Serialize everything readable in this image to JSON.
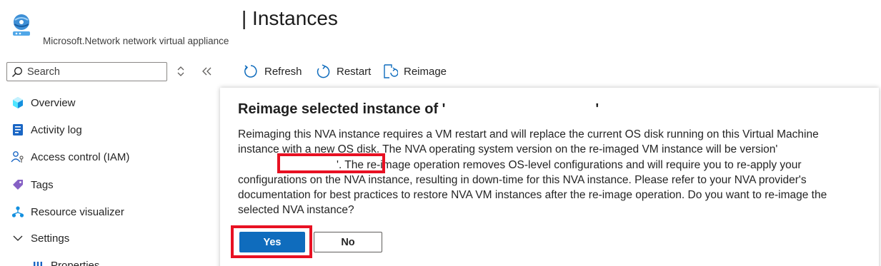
{
  "header": {
    "title": "| Instances",
    "subtitle": "Microsoft.Network network virtual appliance"
  },
  "sidebar": {
    "search_placeholder": "Search",
    "items": [
      {
        "label": "Overview",
        "icon": "overview-icon"
      },
      {
        "label": "Activity log",
        "icon": "activity-log-icon"
      },
      {
        "label": "Access control (IAM)",
        "icon": "access-control-icon"
      },
      {
        "label": "Tags",
        "icon": "tag-icon"
      },
      {
        "label": "Resource visualizer",
        "icon": "resource-visualizer-icon"
      },
      {
        "label": "Settings",
        "icon": "chevron-down-icon"
      },
      {
        "label": "Properties",
        "icon": "properties-icon"
      }
    ]
  },
  "toolbar": {
    "refresh_label": "Refresh",
    "restart_label": "Restart",
    "reimage_label": "Reimage"
  },
  "dialog": {
    "title": "Reimage selected instance of '",
    "title_end": "'",
    "body_part1": "Reimaging this NVA instance requires a VM restart and will replace the current OS disk running on this Virtual Machine instance with a new OS disk. The NVA operating system version on the re-imaged VM instance will be version",
    "quote_open": "'",
    "quote_close": "'.",
    "body_part2": " The re-image operation removes OS-level configurations and will require you to re-apply your configurations on the NVA instance, resulting in down-time for this NVA instance. Please refer to your NVA provider's documentation for best practices to restore NVA VM instances after the re-image operation. Do you want to re-image the selected NVA instance?",
    "yes_label": "Yes",
    "no_label": "No"
  },
  "colors": {
    "primary_button": "#0f6cbd",
    "highlight": "#e81123"
  }
}
